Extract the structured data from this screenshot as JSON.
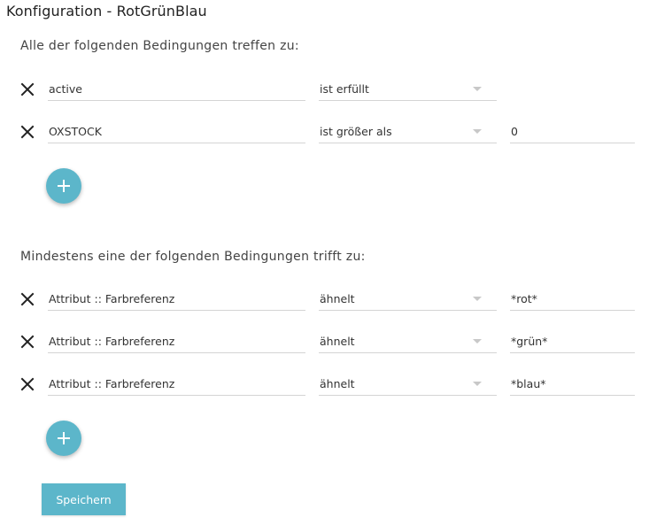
{
  "page": {
    "title": "Konfiguration - RotGrünBlau"
  },
  "groups": [
    {
      "heading": "Alle der folgenden Bedingungen treffen zu:",
      "rows": [
        {
          "attribute": "active",
          "operator": "ist erfüllt",
          "value": ""
        },
        {
          "attribute": "OXSTOCK",
          "operator": "ist größer als",
          "value": "0"
        }
      ]
    },
    {
      "heading": "Mindestens eine der folgenden Bedingungen trifft zu:",
      "rows": [
        {
          "attribute": "Attribut :: Farbreferenz",
          "operator": "ähnelt",
          "value": "*rot*"
        },
        {
          "attribute": "Attribut :: Farbreferenz",
          "operator": "ähnelt",
          "value": "*grün*"
        },
        {
          "attribute": "Attribut :: Farbreferenz",
          "operator": "ähnelt",
          "value": "*blau*"
        }
      ]
    }
  ],
  "actions": {
    "save_label": "Speichern"
  },
  "icons": {
    "remove": "close-icon",
    "add": "plus-icon",
    "dropdown": "caret-down-icon"
  },
  "colors": {
    "accent": "#5cb6ca"
  }
}
